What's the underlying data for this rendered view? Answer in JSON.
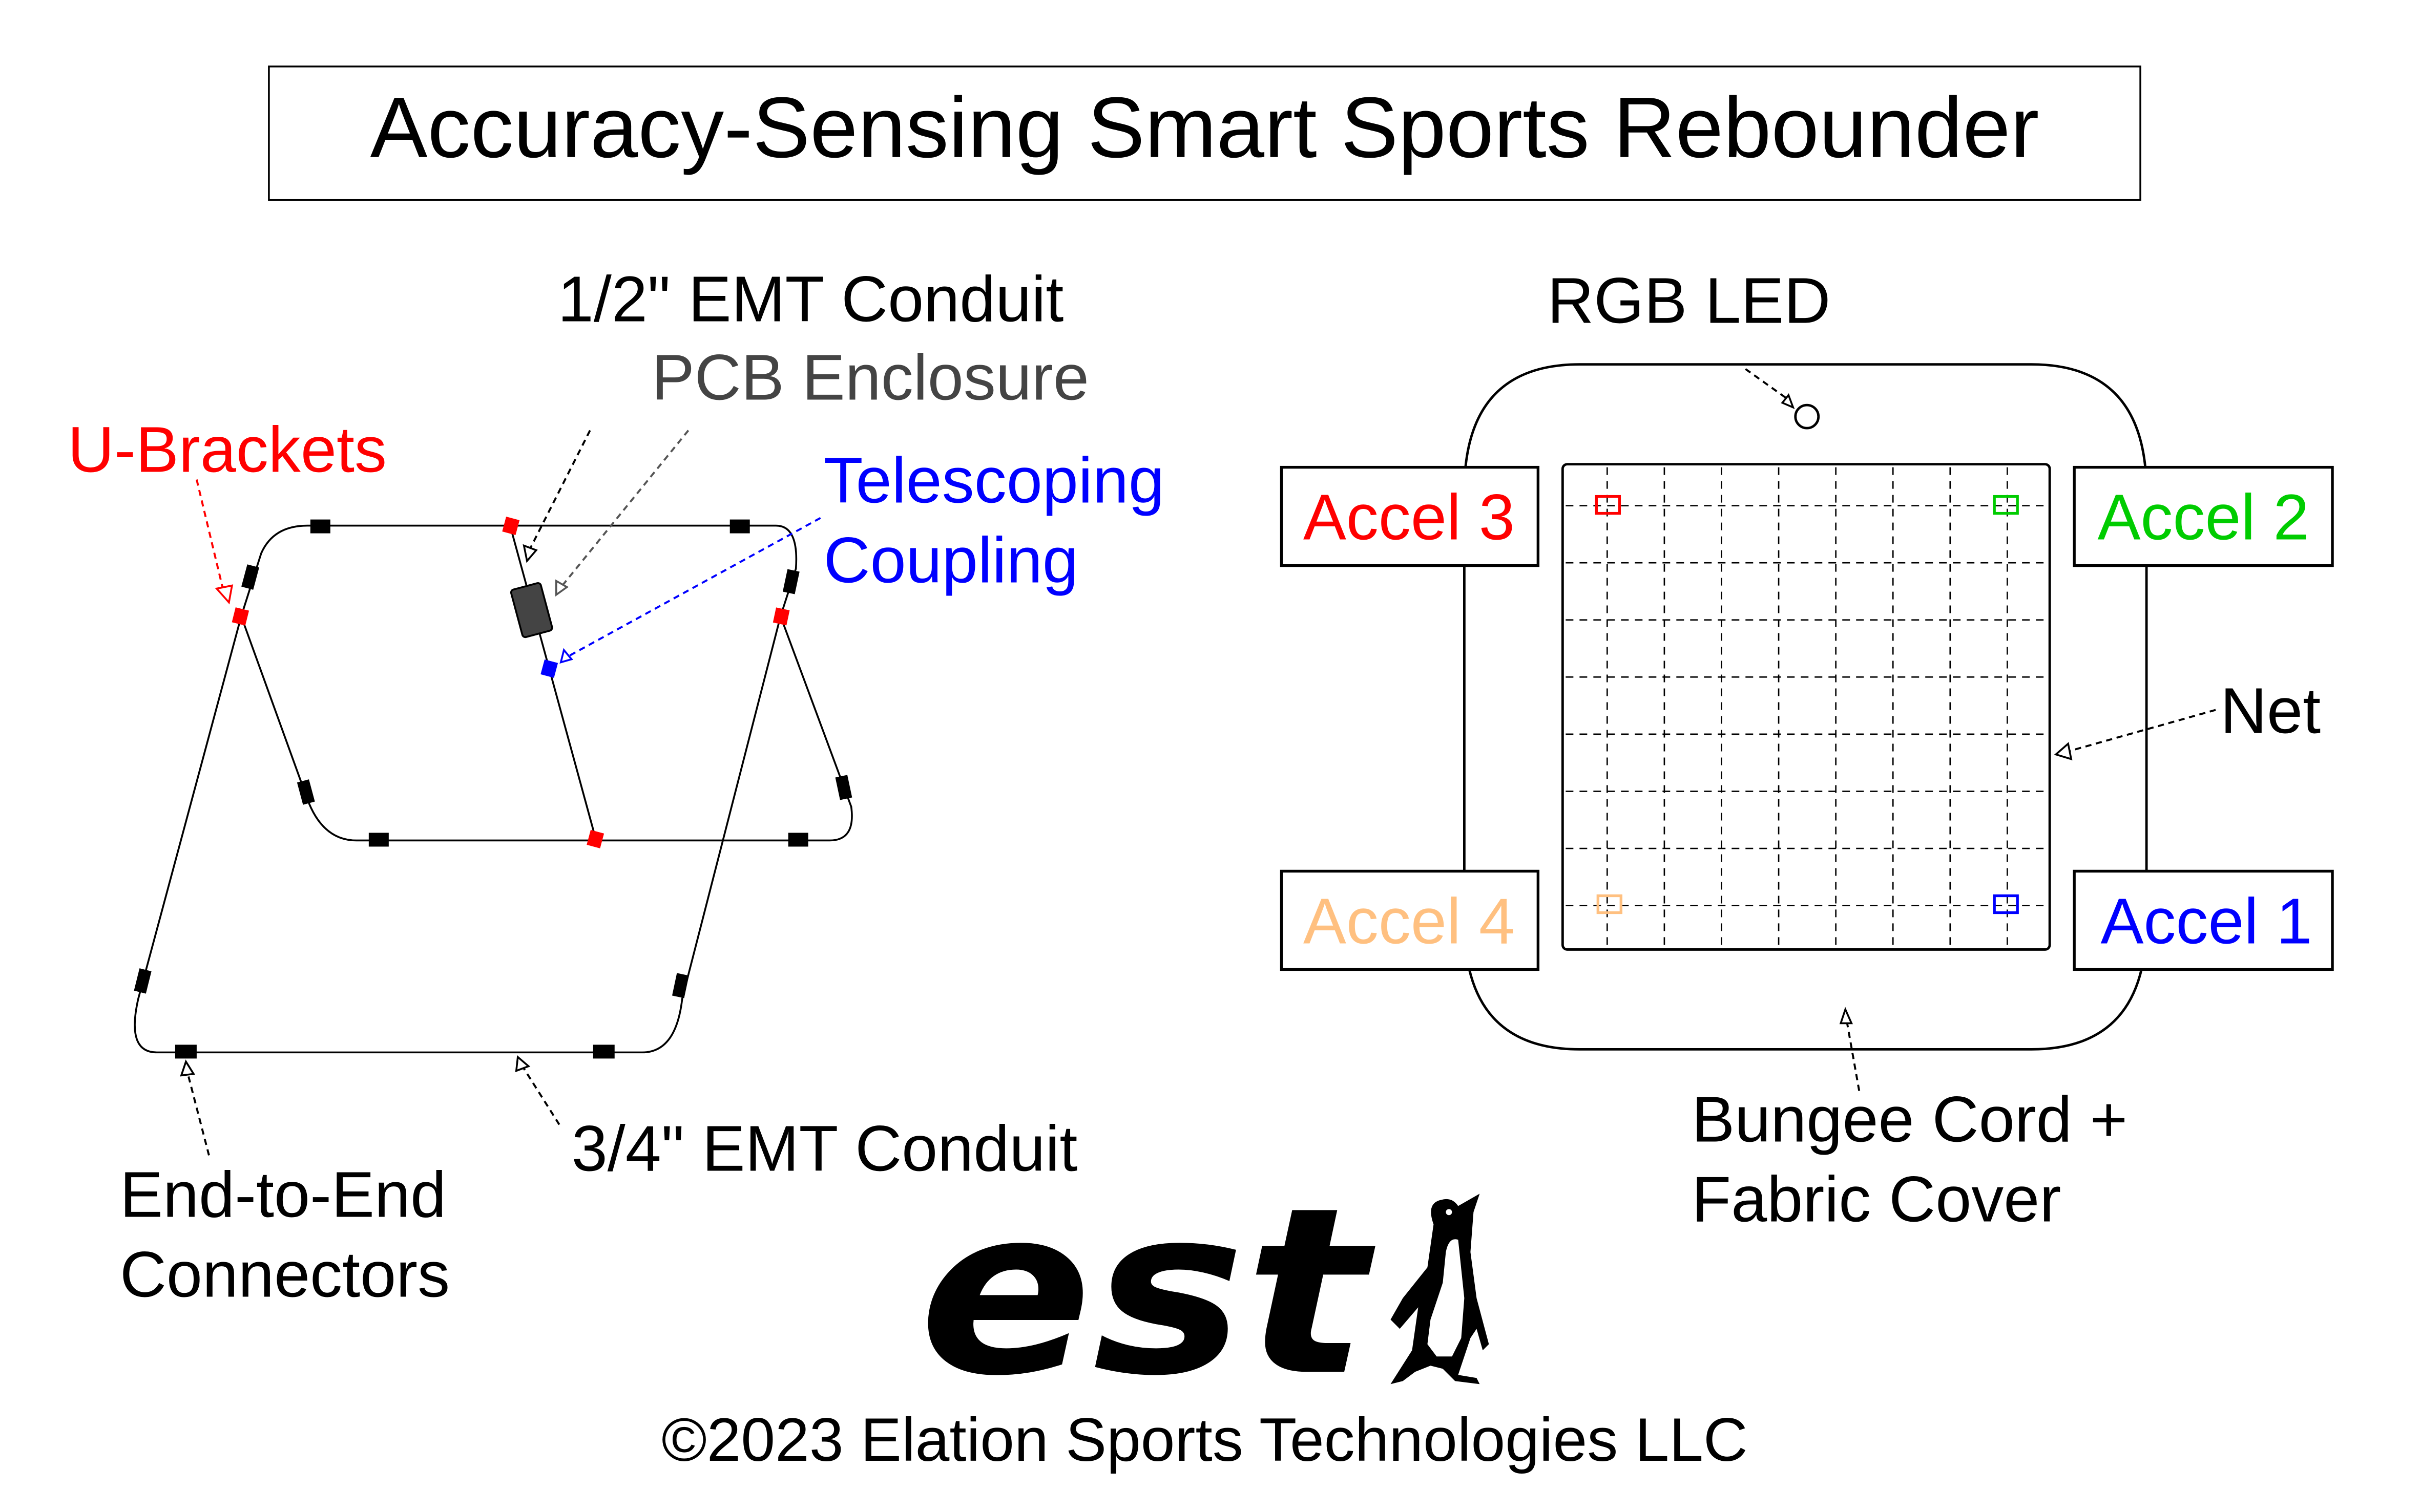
{
  "title": "Accuracy-Sensing Smart Sports Rebounder",
  "frame_diagram": {
    "labels": {
      "half_inch_conduit": "1/2\" EMT Conduit",
      "pcb_enclosure": "PCB Enclosure",
      "u_brackets": "U-Brackets",
      "telescoping_line1": "Telescoping",
      "telescoping_line2": "Coupling",
      "three_quarter_conduit": "3/4\" EMT Conduit",
      "end_to_end_line1": "End-to-End",
      "end_to_end_line2": "Connectors"
    },
    "colors": {
      "u_brackets": "#ff0000",
      "pcb_enclosure": "#444444",
      "telescoping": "#0000ff",
      "connectors": "#000000"
    }
  },
  "net_diagram": {
    "labels": {
      "rgb_led": "RGB LED",
      "net": "Net",
      "bungee_line1": "Bungee Cord +",
      "bungee_line2": "Fabric Cover"
    },
    "accelerometers": [
      {
        "label": "Accel 1",
        "color": "#0000ff",
        "position": "bottom-right"
      },
      {
        "label": "Accel 2",
        "color": "#00cc00",
        "position": "top-right"
      },
      {
        "label": "Accel 3",
        "color": "#ff0000",
        "position": "top-left"
      },
      {
        "label": "Accel 4",
        "color": "#ffc080",
        "position": "bottom-left"
      }
    ]
  },
  "logo": {
    "text": "est",
    "icon": "penguin-icon"
  },
  "copyright": "©2023 Elation Sports Technologies LLC"
}
